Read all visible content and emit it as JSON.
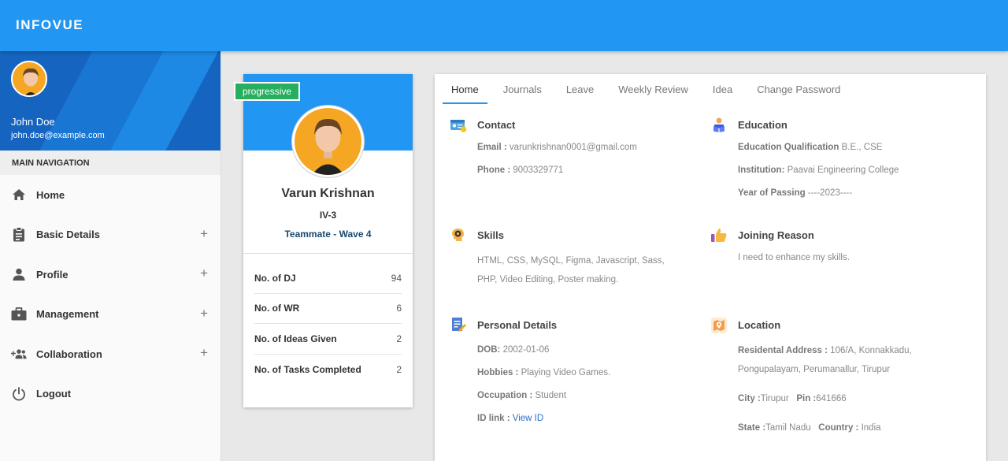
{
  "app": {
    "brand": "INFOVUE"
  },
  "user": {
    "name": "John Doe",
    "email": "john.doe@example.com"
  },
  "sidebar": {
    "header": "MAIN NAVIGATION",
    "items": [
      {
        "label": "Home",
        "icon": "home-icon",
        "expandable": false
      },
      {
        "label": "Basic Details",
        "icon": "clipboard-icon",
        "expandable": true
      },
      {
        "label": "Profile",
        "icon": "person-icon",
        "expandable": true
      },
      {
        "label": "Management",
        "icon": "briefcase-icon",
        "expandable": true
      },
      {
        "label": "Collaboration",
        "icon": "group-add-icon",
        "expandable": true
      },
      {
        "label": "Logout",
        "icon": "power-icon",
        "expandable": false
      }
    ],
    "expand_symbol": "+"
  },
  "profile": {
    "badge": "progressive",
    "name": "Varun Krishnan",
    "class": "IV-3",
    "team": "Teammate - Wave 4",
    "stats": [
      {
        "label": "No. of DJ",
        "value": "94"
      },
      {
        "label": "No. of WR",
        "value": "6"
      },
      {
        "label": "No. of Ideas Given",
        "value": "2"
      },
      {
        "label": "No. of Tasks Completed",
        "value": "2"
      }
    ]
  },
  "tabs": [
    "Home",
    "Journals",
    "Leave",
    "Weekly Review",
    "Idea",
    "Change Password"
  ],
  "active_tab": "Home",
  "contact": {
    "title": "Contact",
    "email_label": "Email :",
    "email": "varunkrishnan0001@gmail.com",
    "phone_label": "Phone :",
    "phone": "9003329771"
  },
  "education": {
    "title": "Education",
    "qual_label": "Education Qualification",
    "qual": "B.E., CSE",
    "inst_label": "Institution:",
    "inst": "Paavai Engineering College",
    "year_label": "Year of Passing",
    "year": "----2023----"
  },
  "skills": {
    "title": "Skills",
    "line1": "HTML, CSS, MySQL, Figma, Javascript, Sass,",
    "line2": "PHP, Video Editing, Poster making."
  },
  "joining": {
    "title": "Joining Reason",
    "text": "I need to enhance my skills."
  },
  "personal": {
    "title": "Personal Details",
    "dob_label": "DOB:",
    "dob": "2002-01-06",
    "hobbies_label": "Hobbies :",
    "hobbies": "Playing Video Games.",
    "occupation_label": "Occupation :",
    "occupation": "Student",
    "id_label": "ID link :",
    "id_link": "View ID"
  },
  "location": {
    "title": "Location",
    "addr_label": "Residental Address :",
    "addr1": "106/A, Konnakkadu,",
    "addr2": "Pongupalayam, Perumanallur, Tirupur",
    "city_label": "City :",
    "city": "Tirupur",
    "pin_label": "Pin :",
    "pin": "641666",
    "state_label": "State :",
    "state": "Tamil Nadu",
    "country_label": "Country :",
    "country": "India"
  },
  "colors": {
    "primary": "#2196f3",
    "badge": "#27ae60",
    "team_text": "#1a4a72",
    "link": "#2a6fc9"
  }
}
